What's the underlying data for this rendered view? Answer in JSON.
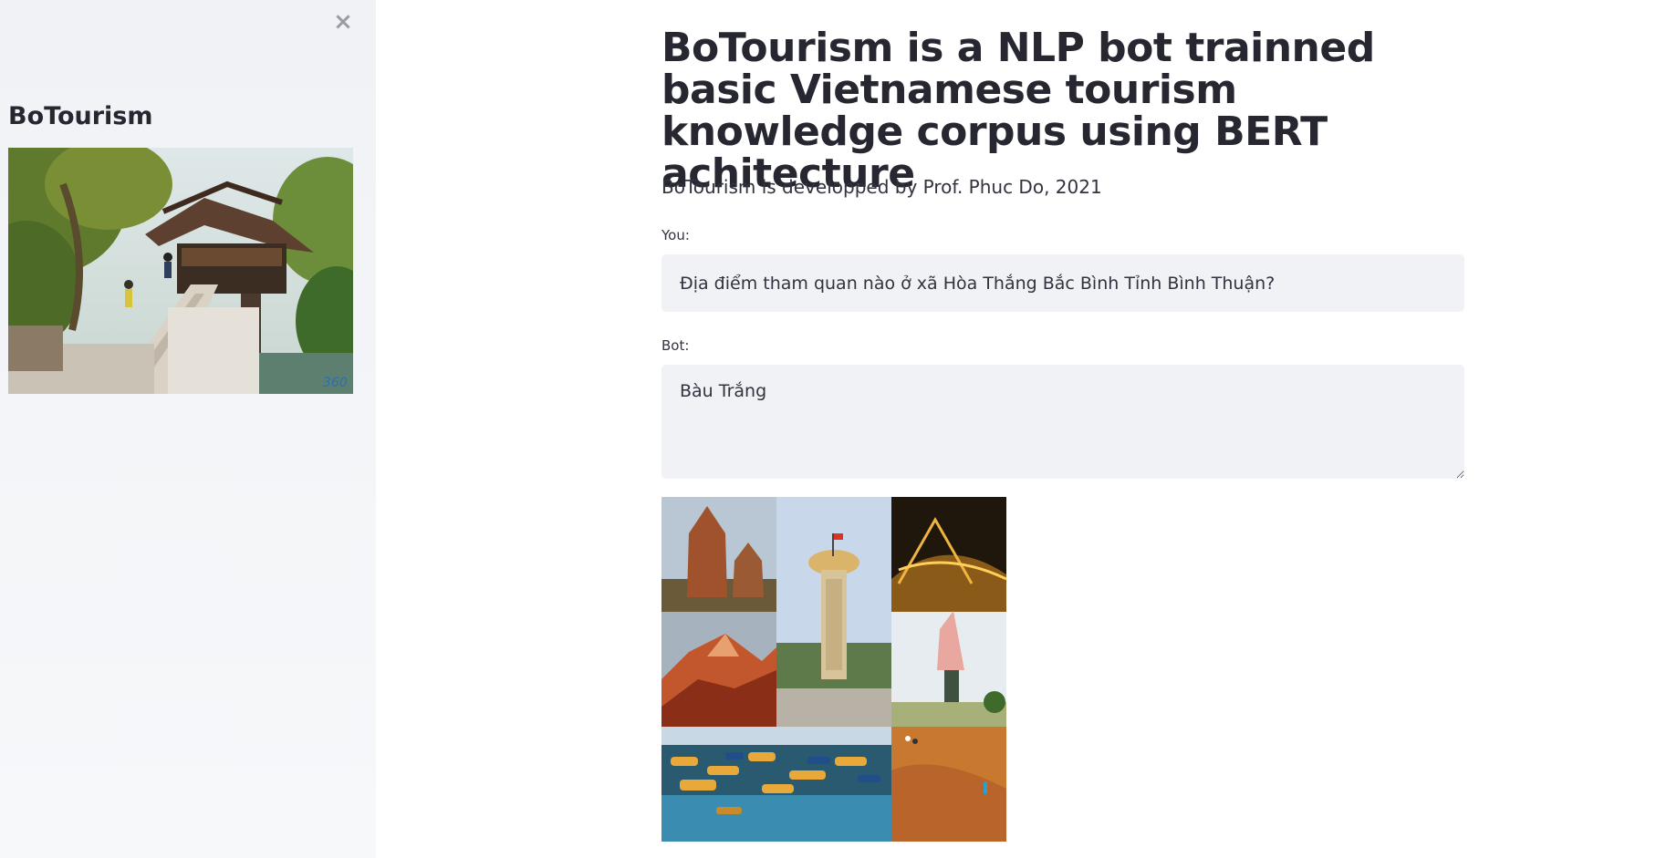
{
  "sidebar": {
    "close_glyph": "×",
    "title": "BoTourism",
    "image_icon": "one-pillar-pagoda-image",
    "image_watermark": "360"
  },
  "main": {
    "title": "BoTourism is a NLP bot trainned basic Vietnamese tourism knowledge corpus using BERT achitecture",
    "subtitle": "BoTourism is developped by Prof. Phuc Do, 2021",
    "you_label": "You:",
    "you_value": "Địa điểm tham quan nào ở xã Hòa Thắng Bắc Bình Tỉnh Bình Thuận?",
    "bot_label": "Bot:",
    "bot_value": "Bàu Trắng",
    "result_image_icon": "binh-thuan-collage-image"
  },
  "colors": {
    "sidebar_bg": "#f0f2f6",
    "input_bg": "#f0f2f6",
    "text": "#262730"
  }
}
